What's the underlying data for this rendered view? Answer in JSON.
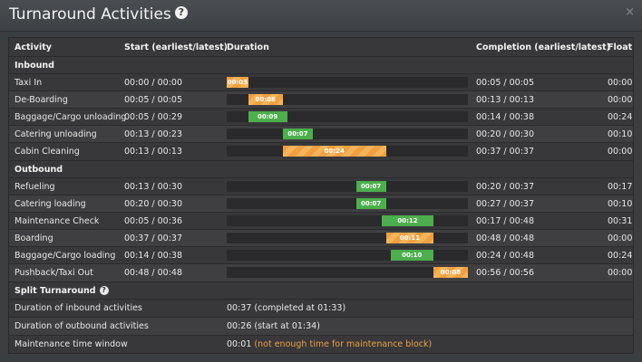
{
  "window": {
    "title": "Turnaround Activities",
    "close": "×"
  },
  "headers": {
    "activity": "Activity",
    "start": "Start (earliest/latest)",
    "duration": "Duration",
    "completion": "Completion (earliest/latest)",
    "float": "Float"
  },
  "sections": {
    "inbound": "Inbound",
    "outbound": "Outbound",
    "split": "Split Turnaround"
  },
  "inbound": [
    {
      "activity": "Taxi In",
      "start": "00:00 / 00:00",
      "bar_label": "00:05",
      "completion": "00:05 / 00:05",
      "float": "00:00"
    },
    {
      "activity": "De-Boarding",
      "start": "00:05 / 00:05",
      "bar_label": "00:08",
      "completion": "00:13 / 00:13",
      "float": "00:00"
    },
    {
      "activity": "Baggage/Cargo unloading",
      "start": "00:05 / 00:29",
      "bar_label": "00:09",
      "completion": "00:14 / 00:38",
      "float": "00:24"
    },
    {
      "activity": "Catering unloading",
      "start": "00:13 / 00:23",
      "bar_label": "00:07",
      "completion": "00:20 / 00:30",
      "float": "00:10"
    },
    {
      "activity": "Cabin Cleaning",
      "start": "00:13 / 00:13",
      "bar_label": "00:24",
      "completion": "00:37 / 00:37",
      "float": "00:00"
    }
  ],
  "outbound": [
    {
      "activity": "Refueling",
      "start": "00:13 / 00:30",
      "bar_label": "00:07",
      "completion": "00:20 / 00:37",
      "float": "00:17"
    },
    {
      "activity": "Catering loading",
      "start": "00:20 / 00:30",
      "bar_label": "00:07",
      "completion": "00:27 / 00:37",
      "float": "00:10"
    },
    {
      "activity": "Maintenance Check",
      "start": "00:05 / 00:36",
      "bar_label": "00:12",
      "completion": "00:17 / 00:48",
      "float": "00:31"
    },
    {
      "activity": "Boarding",
      "start": "00:37 / 00:37",
      "bar_label": "00:11",
      "completion": "00:48 / 00:48",
      "float": "00:00"
    },
    {
      "activity": "Baggage/Cargo loading",
      "start": "00:14 / 00:38",
      "bar_label": "00:10",
      "completion": "00:24 / 00:48",
      "float": "00:24"
    },
    {
      "activity": "Pushback/Taxi Out",
      "start": "00:48 / 00:48",
      "bar_label": "00:08",
      "completion": "00:56 / 00:56",
      "float": "00:00"
    }
  ],
  "split": [
    {
      "label": "Duration of inbound activities",
      "value": "00:37 (completed at 01:33)"
    },
    {
      "label": "Duration of outbound activities",
      "value": "00:26 (start at 01:34)"
    },
    {
      "label": "Maintenance time window",
      "value": "00:01",
      "warning": "(not enough time for maintenance block)"
    }
  ],
  "colors": {
    "critical": "#f0a040",
    "float": "#4cae4c"
  },
  "bars": {
    "inbound": [
      {
        "start_min": 0,
        "dur_min": 5,
        "type": "critical"
      },
      {
        "start_min": 5,
        "dur_min": 8,
        "type": "critical"
      },
      {
        "start_min": 5,
        "dur_min": 9,
        "type": "float"
      },
      {
        "start_min": 13,
        "dur_min": 7,
        "type": "float"
      },
      {
        "start_min": 13,
        "dur_min": 24,
        "type": "critical"
      }
    ],
    "outbound": [
      {
        "start_min": 30,
        "dur_min": 7,
        "type": "float"
      },
      {
        "start_min": 30,
        "dur_min": 7,
        "type": "float"
      },
      {
        "start_min": 36,
        "dur_min": 12,
        "type": "float"
      },
      {
        "start_min": 37,
        "dur_min": 11,
        "type": "critical"
      },
      {
        "start_min": 38,
        "dur_min": 10,
        "type": "float"
      },
      {
        "start_min": 48,
        "dur_min": 8,
        "type": "critical"
      }
    ],
    "scale_max_min": 56
  }
}
